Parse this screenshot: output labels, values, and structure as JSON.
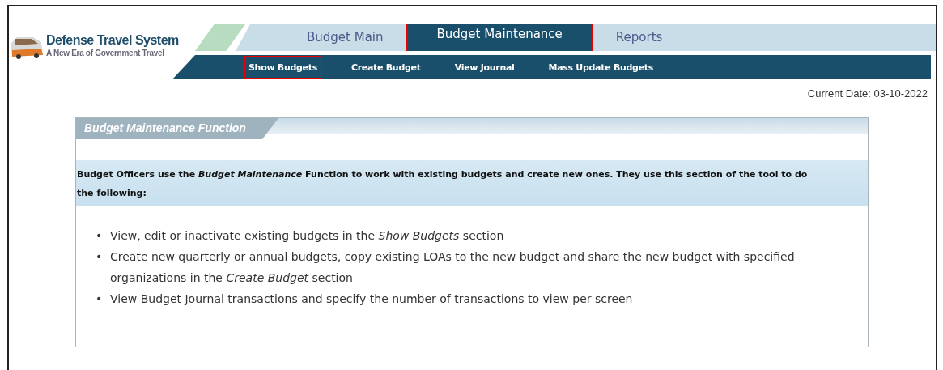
{
  "logo": {
    "title": "Defense Travel System",
    "tagline": "A New Era of Government Travel"
  },
  "tabs": [
    {
      "label": "Budget Main",
      "selected": false,
      "highlighted": false
    },
    {
      "label": "Budget Maintenance",
      "selected": true,
      "highlighted": true
    },
    {
      "label": "Reports",
      "selected": false,
      "highlighted": false
    }
  ],
  "subnav": [
    {
      "label": "Show Budgets",
      "highlighted": true
    },
    {
      "label": "Create Budget",
      "highlighted": false
    },
    {
      "label": "View Journal",
      "highlighted": false
    },
    {
      "label": "Mass Update Budgets",
      "highlighted": false
    }
  ],
  "current_date": "Current Date: 03-10-2022",
  "panel": {
    "title": "Budget Maintenance Function",
    "intro": "Budget Officers use the *Budget Maintenance* Function to work with existing budgets and create new ones. They use this section of the tool to do the following:",
    "bullets": [
      {
        "marker": "•",
        "text": "View, edit or inactivate existing budgets in the *Show Budgets* section"
      },
      {
        "marker": "•",
        "text": "Create new quarterly or annual budgets, copy existing LOAs to the new budget and share the new budget with specified organizations in the *Create Budget* section"
      },
      {
        "marker": "•",
        "text": "View Budget Journal transactions and specify the number of transactions to view per screen"
      }
    ]
  }
}
